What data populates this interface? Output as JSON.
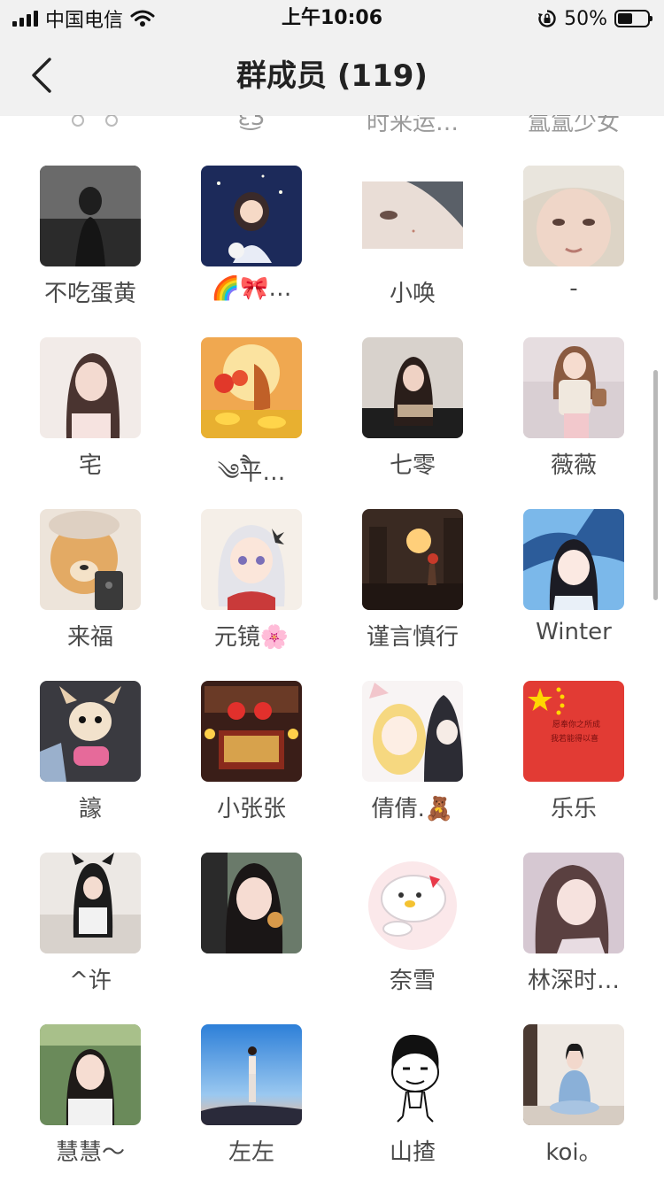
{
  "status_bar": {
    "carrier": "中国电信",
    "time": "上午10:06",
    "battery_text": "50%",
    "battery_level": 0.5,
    "icons": [
      "signal-icon",
      "wifi-icon",
      "rotation-lock-icon",
      "battery-icon"
    ]
  },
  "nav": {
    "title": "群成员 (119)",
    "back_icon": "chevron-left-icon"
  },
  "partial_row": [
    "ε͜͡3",
    "时来运…",
    "氲氲少女"
  ],
  "members": [
    {
      "name": "不吃蛋黄"
    },
    {
      "name": "🌈🎀…"
    },
    {
      "name": "小唤"
    },
    {
      "name": "-"
    },
    {
      "name": "宅"
    },
    {
      "name": "༄ཻ平…"
    },
    {
      "name": "七零"
    },
    {
      "name": "薇薇"
    },
    {
      "name": "来福"
    },
    {
      "name": "元镜🌸"
    },
    {
      "name": "谨言慎行"
    },
    {
      "name": "Winter"
    },
    {
      "name": "譹"
    },
    {
      "name": "小张张"
    },
    {
      "name": "倩倩.🧸"
    },
    {
      "name": "乐乐"
    },
    {
      "name": "^许"
    },
    {
      "name": ""
    },
    {
      "name": "奈雪"
    },
    {
      "name": "林深时…"
    },
    {
      "name": "慧慧～"
    },
    {
      "name": "左左"
    },
    {
      "name": "山揸"
    },
    {
      "name": "koi。"
    }
  ],
  "flag_avatar_text": [
    "愿奉你之所成",
    "我若能得以喜"
  ],
  "colors": {
    "header_bg": "#f1f1f1",
    "name_text": "#4a4a4a",
    "flag_red": "#e23b34",
    "flag_star": "#ffd700"
  }
}
